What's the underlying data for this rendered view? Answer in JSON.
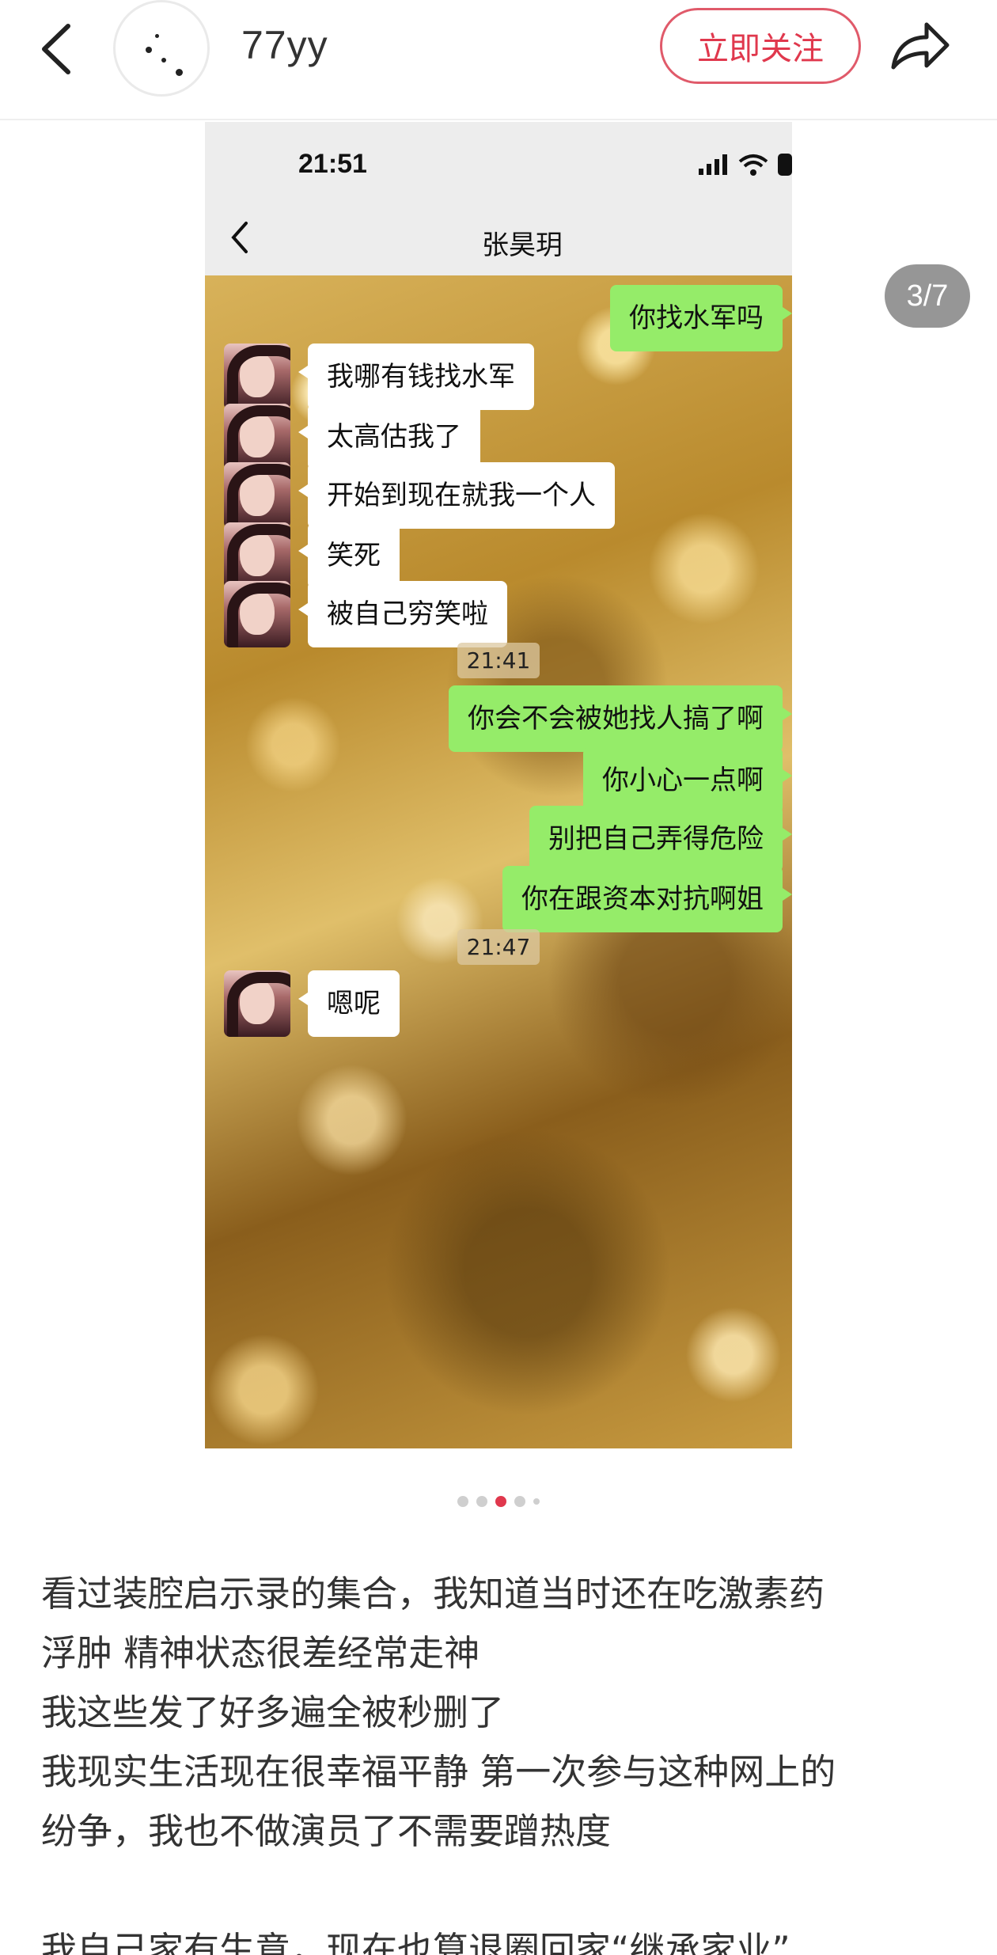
{
  "header": {
    "username": "77yy",
    "follow_label": "立即关注"
  },
  "image_counter": "3/7",
  "phone": {
    "status_time": "21:51",
    "chat_title": "张昊玥",
    "messages": [
      {
        "side": "out",
        "text": "你找水军吗"
      },
      {
        "side": "in",
        "text": "我哪有钱找水军"
      },
      {
        "side": "in",
        "text": "太高估我了"
      },
      {
        "side": "in",
        "text": "开始到现在就我一个人"
      },
      {
        "side": "in",
        "text": "笑死"
      },
      {
        "side": "in",
        "text": "被自己穷笑啦"
      },
      {
        "side": "out",
        "text": "你会不会被她找人搞了啊"
      },
      {
        "side": "out",
        "text": "你小心一点啊"
      },
      {
        "side": "out",
        "text": "别把自己弄得危险"
      },
      {
        "side": "out",
        "text": "你在跟资本对抗啊姐"
      },
      {
        "side": "in",
        "text": "嗯呢"
      }
    ],
    "timestamps": [
      "21:41",
      "21:47"
    ]
  },
  "pagination": {
    "total": 5,
    "active_index": 2
  },
  "post_lines": [
    "看过装腔启示录的集合，我知道当时还在吃激素药",
    "浮肿 精神状态很差经常走神",
    "我这些发了好多遍全被秒删了",
    "我现实生活现在很幸福平静 第一次参与这种网上的",
    "纷争，我也不做演员了不需要蹭热度",
    "",
    "我自己家有生意，现在也算退圈回家“继承家业”"
  ]
}
